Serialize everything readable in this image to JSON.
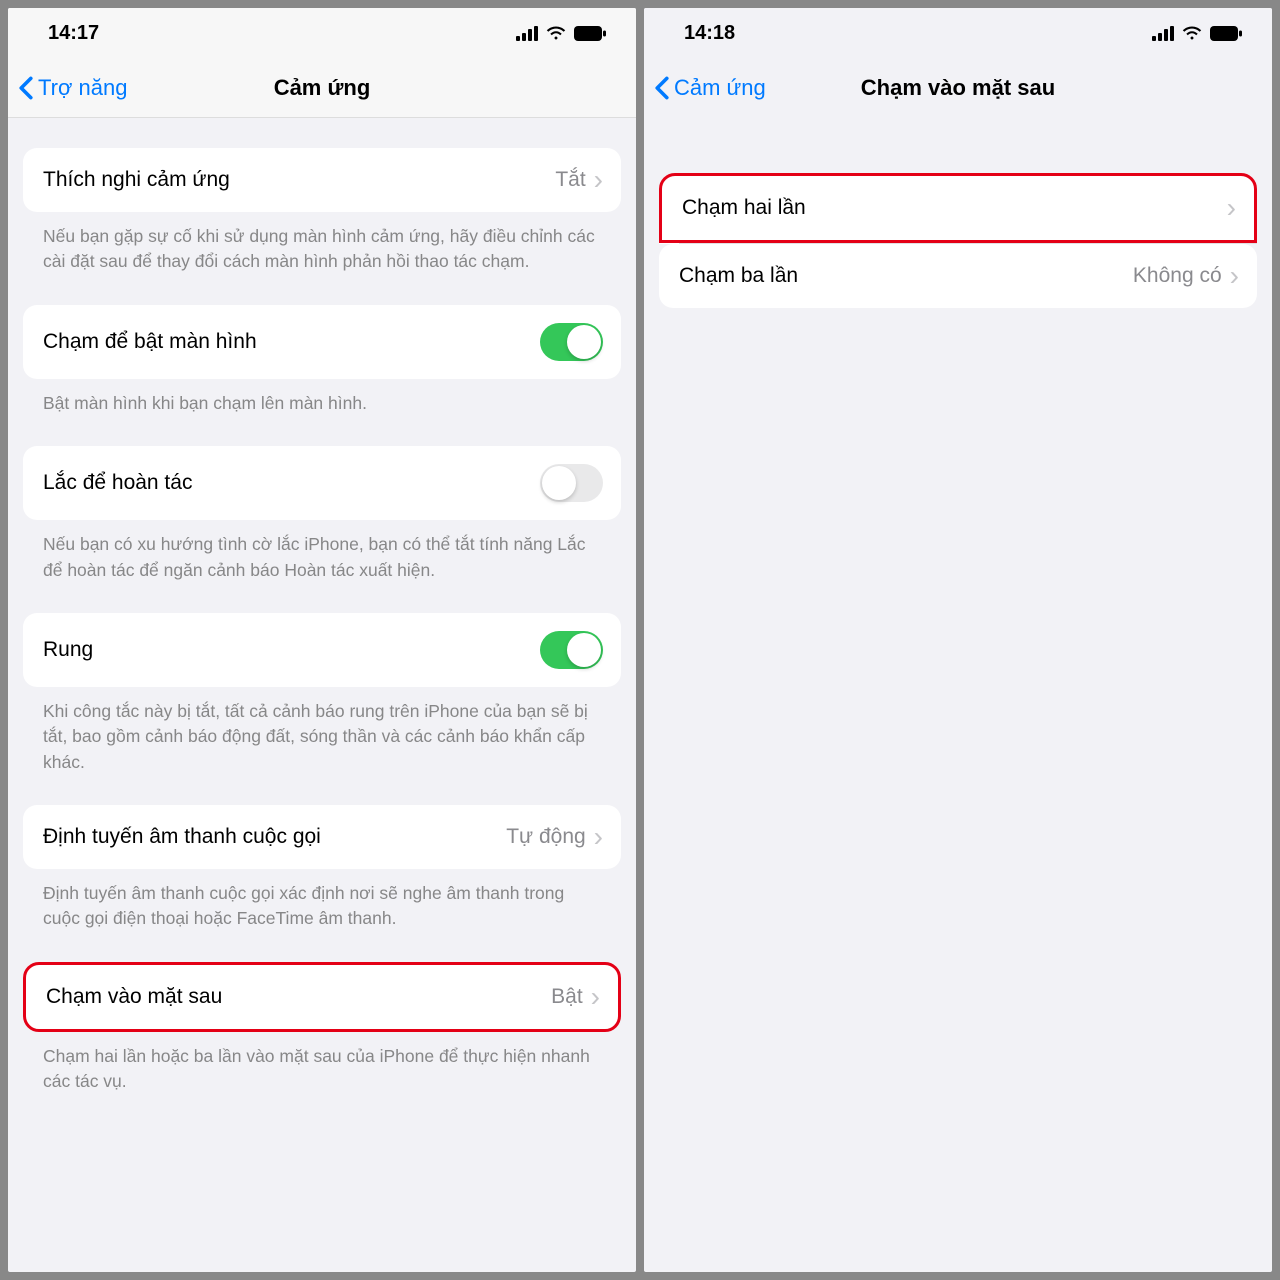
{
  "left": {
    "status_time": "14:17",
    "back_label": "Trợ năng",
    "title": "Cảm ứng",
    "rows": {
      "adapt": {
        "label": "Thích nghi cảm ứng",
        "value": "Tắt"
      },
      "adapt_footer": "Nếu bạn gặp sự cố khi sử dụng màn hình cảm ứng, hãy điều chỉnh các cài đặt sau để thay đổi cách màn hình phản hồi thao tác chạm.",
      "taptowake": {
        "label": "Chạm để bật màn hình"
      },
      "taptowake_footer": "Bật màn hình khi bạn chạm lên màn hình.",
      "shake": {
        "label": "Lắc để hoàn tác"
      },
      "shake_footer": "Nếu bạn có xu hướng tình cờ lắc iPhone, bạn có thể tắt tính năng Lắc để hoàn tác để ngăn cảnh báo Hoàn tác xuất hiện.",
      "vibe": {
        "label": "Rung"
      },
      "vibe_footer": "Khi công tắc này bị tắt, tất cả cảnh báo rung trên iPhone của bạn sẽ bị tắt, bao gồm cảnh báo động đất, sóng thần và các cảnh báo khẩn cấp khác.",
      "audio": {
        "label": "Định tuyến âm thanh cuộc gọi",
        "value": "Tự động"
      },
      "audio_footer": "Định tuyến âm thanh cuộc gọi xác định nơi sẽ nghe âm thanh trong cuộc gọi điện thoại hoặc FaceTime âm thanh.",
      "backtap": {
        "label": "Chạm vào mặt sau",
        "value": "Bật"
      },
      "backtap_footer": "Chạm hai lần hoặc ba lần vào mặt sau của iPhone để thực hiện nhanh các tác vụ."
    }
  },
  "right": {
    "status_time": "14:18",
    "back_label": "Cảm ứng",
    "title": "Chạm vào mặt sau",
    "rows": {
      "double": {
        "label": "Chạm hai lần",
        "value": ""
      },
      "triple": {
        "label": "Chạm ba lần",
        "value": "Không có"
      }
    }
  }
}
